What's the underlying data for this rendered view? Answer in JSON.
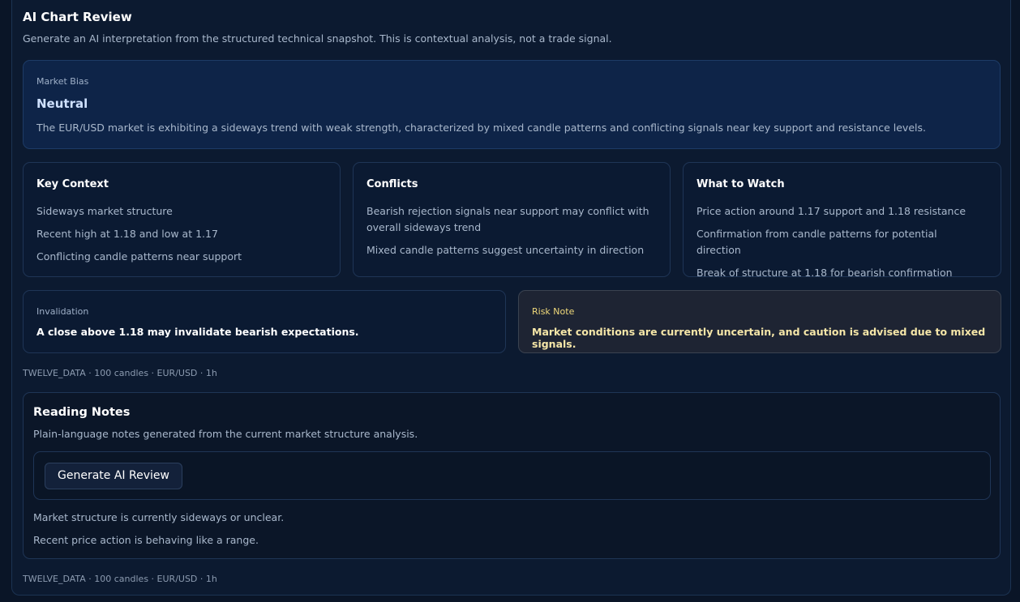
{
  "review": {
    "title": "AI Chart Review",
    "subtitle": "Generate an AI interpretation from the structured technical snapshot. This is contextual analysis, not a trade signal."
  },
  "bias": {
    "label": "Market Bias",
    "value": "Neutral",
    "description": "The EUR/USD market is exhibiting a sideways trend with weak strength, characterized by mixed candle patterns and conflicting signals near key support and resistance levels."
  },
  "cards": [
    {
      "title": "Key Context",
      "items": [
        "Sideways market structure",
        "Recent high at 1.18 and low at 1.17",
        "Conflicting candle patterns near support"
      ]
    },
    {
      "title": "Conflicts",
      "items": [
        "Bearish rejection signals near support may conflict with overall sideways trend",
        "Mixed candle patterns suggest uncertainty in direction"
      ]
    },
    {
      "title": "What to Watch",
      "items": [
        "Price action around 1.17 support and 1.18 resistance",
        "Confirmation from candle patterns for potential direction",
        "Break of structure at 1.18 for bearish confirmation"
      ]
    }
  ],
  "invalidation": {
    "label": "Invalidation",
    "text": "A close above 1.18 may invalidate bearish expectations."
  },
  "risk": {
    "label": "Risk Note",
    "text": "Market conditions are currently uncertain, and caution is advised due to mixed signals."
  },
  "meta_top": "TWELVE_DATA · 100 candles · EUR/USD · 1h",
  "notes": {
    "title": "Reading Notes",
    "subtitle": "Plain-language notes generated from the current market structure analysis.",
    "button_label": "Generate AI Review",
    "lines": [
      "Market structure is currently sideways or unclear.",
      "Recent price action is behaving like a range."
    ]
  },
  "meta_bottom": "TWELVE_DATA · 100 candles · EUR/USD · 1h",
  "colors": {
    "background": "#0a1527",
    "bias_panel": "#0e2448",
    "risk_panel": "#1e2433",
    "risk_label": "#f0d97a",
    "bias_value": "#cfe1ff"
  }
}
